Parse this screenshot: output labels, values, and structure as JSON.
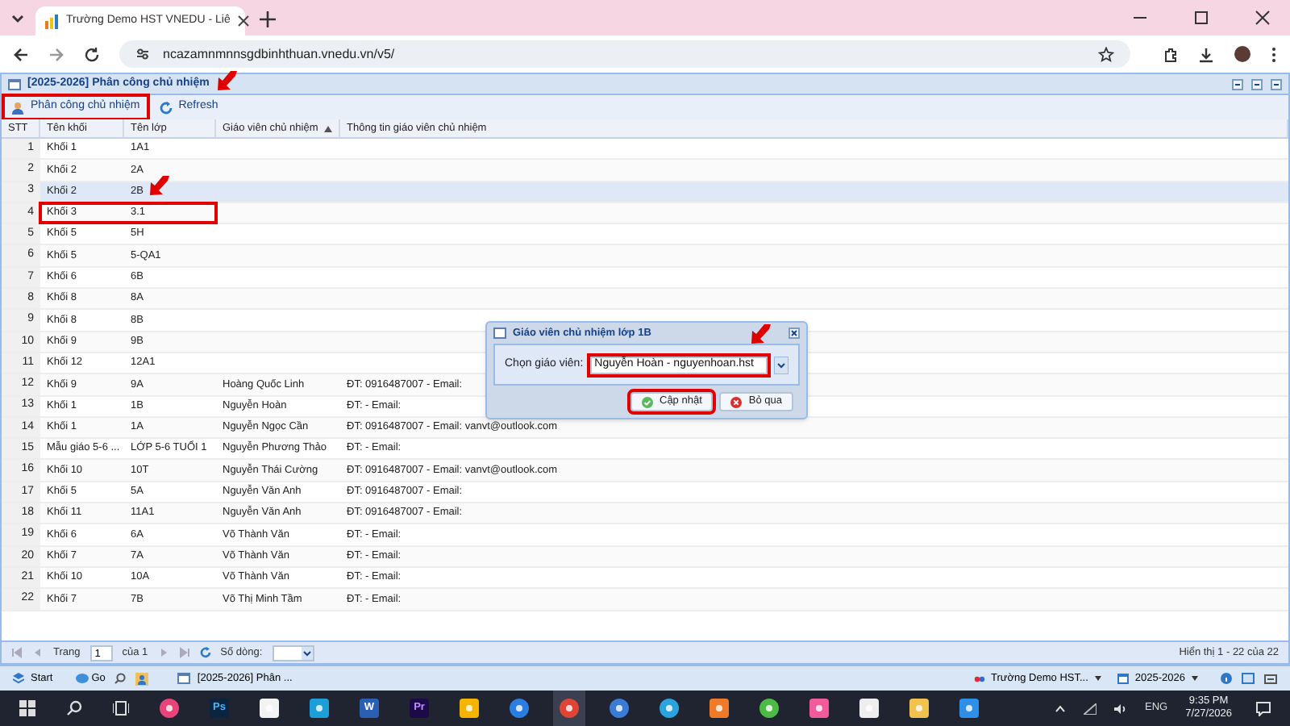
{
  "browser": {
    "tab_title": "Trường Demo HST VNEDU - Liê",
    "url": "ncazamnmnnsgdbinhthuan.vnedu.vn/v5/"
  },
  "panel": {
    "title": "[2025-2026] Phân công chủ nhiệm"
  },
  "toolbar": [
    {
      "label": "Phân công chủ nhiệm",
      "kind": "assign",
      "annotated": true
    },
    {
      "label": "Refresh",
      "kind": "refresh",
      "annotated": false
    }
  ],
  "columns": [
    {
      "label": "STT",
      "sorted": false
    },
    {
      "label": "Tên khối",
      "sorted": false
    },
    {
      "label": "Tên lớp",
      "sorted": false
    },
    {
      "label": "Giáo viên chủ nhiệm",
      "sorted": true
    },
    {
      "label": "Thông tin giáo viên chủ nhiệm",
      "sorted": false
    }
  ],
  "rows": [
    {
      "stt": "1",
      "grade": "Khối 1",
      "class": "1A1",
      "selected": false,
      "annotated": false
    },
    {
      "stt": "2",
      "grade": "Khối 2",
      "class": "2A",
      "selected": false,
      "annotated": false
    },
    {
      "stt": "3",
      "grade": "Khối 2",
      "class": "2B",
      "selected": true,
      "annotated": false
    },
    {
      "stt": "4",
      "grade": "Khối 3",
      "class": "3.1",
      "selected": false,
      "annotated": true
    },
    {
      "stt": "5",
      "grade": "Khối 5",
      "class": "5H",
      "selected": false,
      "annotated": false
    },
    {
      "stt": "6",
      "grade": "Khối 5",
      "class": "5-QA1",
      "selected": false,
      "annotated": false
    },
    {
      "stt": "7",
      "grade": "Khối 6",
      "class": "6B",
      "selected": false,
      "annotated": false
    },
    {
      "stt": "8",
      "grade": "Khối 8",
      "class": "8A",
      "selected": false,
      "annotated": false
    },
    {
      "stt": "9",
      "grade": "Khối 8",
      "class": "8B",
      "selected": false,
      "annotated": false
    },
    {
      "stt": "10",
      "grade": "Khối 9",
      "class": "9B",
      "selected": false,
      "annotated": false
    },
    {
      "stt": "11",
      "grade": "Khối 12",
      "class": "12A1",
      "selected": false,
      "annotated": false
    },
    {
      "stt": "12",
      "grade": "Khối 9",
      "class": "9A",
      "teacher": "Hoàng Quốc Linh",
      "info": "ĐT: 0916487007 - Email:",
      "selected": false,
      "annotated": false
    },
    {
      "stt": "13",
      "grade": "Khối 1",
      "class": "1B",
      "teacher": "Nguyễn Hoàn",
      "info": "ĐT: - Email:",
      "selected": false,
      "annotated": false
    },
    {
      "stt": "14",
      "grade": "Khối 1",
      "class": "1A",
      "teacher": "Nguyễn Ngọc Cần",
      "info": "ĐT: 0916487007 - Email: vanvt@outlook.com",
      "selected": false,
      "annotated": false
    },
    {
      "stt": "15",
      "grade": "Mẫu giáo 5-6 ...",
      "class": "LỚP 5-6 TUỔI 1",
      "teacher": "Nguyễn Phương Thảo",
      "info": "ĐT: - Email:",
      "selected": false,
      "annotated": false
    },
    {
      "stt": "16",
      "grade": "Khối 10",
      "class": "10T",
      "teacher": "Nguyễn Thái Cường",
      "info": "ĐT: 0916487007 - Email: vanvt@outlook.com",
      "selected": false,
      "annotated": false
    },
    {
      "stt": "17",
      "grade": "Khối 5",
      "class": "5A",
      "teacher": "Nguyễn Văn Anh",
      "info": "ĐT: 0916487007 - Email:",
      "selected": false,
      "annotated": false
    },
    {
      "stt": "18",
      "grade": "Khối 11",
      "class": "11A1",
      "teacher": "Nguyễn Văn Anh",
      "info": "ĐT: 0916487007 - Email:",
      "selected": false,
      "annotated": false
    },
    {
      "stt": "19",
      "grade": "Khối 6",
      "class": "6A",
      "teacher": "Võ Thành Văn",
      "info": "ĐT: - Email:",
      "selected": false,
      "annotated": false
    },
    {
      "stt": "20",
      "grade": "Khối 7",
      "class": "7A",
      "teacher": "Võ Thành Văn",
      "info": "ĐT: - Email:",
      "selected": false,
      "annotated": false
    },
    {
      "stt": "21",
      "grade": "Khối 10",
      "class": "10A",
      "teacher": "Võ Thành Văn",
      "info": "ĐT: - Email:",
      "selected": false,
      "annotated": false
    },
    {
      "stt": "22",
      "grade": "Khối 7",
      "class": "7B",
      "teacher": "Võ Thị Minh Tầm",
      "info": "ĐT: - Email:",
      "selected": false,
      "annotated": false
    }
  ],
  "dialog": {
    "title": "Giáo viên chủ nhiệm lớp 1B",
    "label": "Chọn giáo viên:",
    "value": "Nguyễn Hoàn - nguyenhoan.hst",
    "annotated": true,
    "buttons": [
      {
        "label": "Cập nhật",
        "kind": "ok",
        "annotated": true
      },
      {
        "label": "Bỏ qua",
        "kind": "cancel",
        "annotated": false
      }
    ]
  },
  "pager": {
    "page_label": "Trang",
    "page": "1",
    "of": "của 1",
    "rows_label": "Số dòng:",
    "summary": "Hiển thị 1 - 22 của 22"
  },
  "app_taskbar": {
    "start": "Start",
    "go": "Go",
    "window": "[2025-2026] Phân ...",
    "school": "Trường Demo HST...",
    "year": "2025-2026"
  },
  "taskbar": {
    "apps": [
      {
        "kind": "music",
        "selected": false
      },
      {
        "kind": "ps",
        "label": "Ps",
        "selected": false
      },
      {
        "kind": "store",
        "selected": false
      },
      {
        "kind": "edge",
        "selected": false
      },
      {
        "kind": "word",
        "label": "W",
        "selected": false
      },
      {
        "kind": "pr",
        "label": "Pr",
        "selected": false
      },
      {
        "kind": "drive",
        "selected": false
      },
      {
        "kind": "chat",
        "selected": false
      },
      {
        "kind": "chrome",
        "selected": true
      },
      {
        "kind": "media",
        "selected": false
      },
      {
        "kind": "telegram",
        "selected": false
      },
      {
        "kind": "orange",
        "selected": false
      },
      {
        "kind": "green",
        "selected": false
      },
      {
        "kind": "tiles",
        "selected": false
      },
      {
        "kind": "calendar",
        "selected": false
      },
      {
        "kind": "folder",
        "selected": false
      },
      {
        "kind": "photo",
        "selected": false
      }
    ],
    "lang": "ENG",
    "time": "9:35 PM",
    "date": "7/27/2026"
  }
}
